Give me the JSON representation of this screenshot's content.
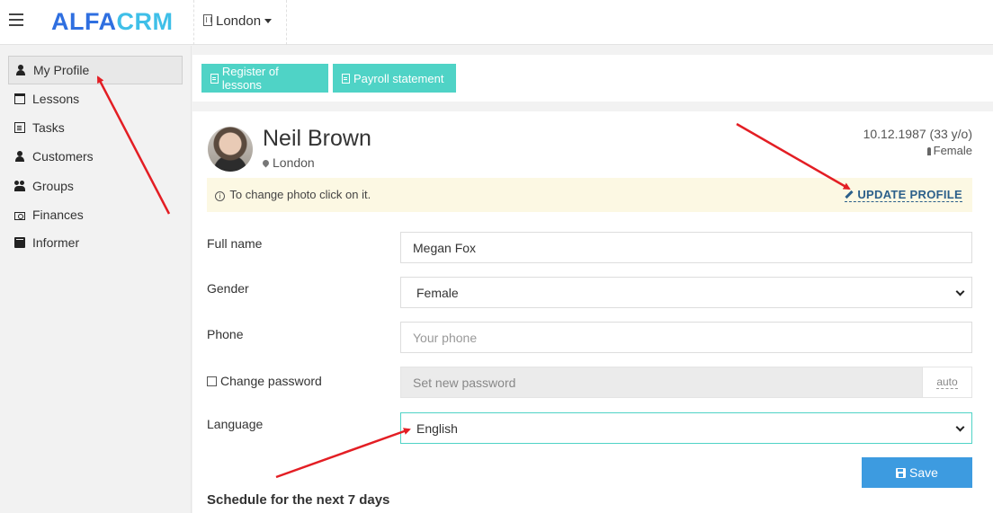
{
  "header": {
    "logo_part1": "ALFA",
    "logo_part2": "CRM",
    "branch": "London"
  },
  "sidebar": {
    "items": [
      {
        "label": "My Profile",
        "icon": "user-icon",
        "active": true
      },
      {
        "label": "Lessons",
        "icon": "calendar-icon"
      },
      {
        "label": "Tasks",
        "icon": "tasks-icon"
      },
      {
        "label": "Customers",
        "icon": "user-icon"
      },
      {
        "label": "Groups",
        "icon": "groups-icon"
      },
      {
        "label": "Finances",
        "icon": "money-icon"
      },
      {
        "label": "Informer",
        "icon": "book-icon"
      }
    ]
  },
  "toolbar": {
    "register_label": "Register of lessons",
    "payroll_label": "Payroll statement"
  },
  "profile": {
    "name": "Neil Brown",
    "city": "London",
    "dob": "10.12.1987 (33 y/o)",
    "gender": "Female",
    "notice": "To change photo click on it.",
    "update_label": "UPDATE PROFILE"
  },
  "form": {
    "fullname_label": "Full name",
    "fullname_value": "Megan Fox",
    "gender_label": "Gender",
    "gender_value": "Female",
    "phone_label": "Phone",
    "phone_placeholder": "Your phone",
    "password_label": "Change password",
    "password_placeholder": "Set new password",
    "password_addon": "auto",
    "language_label": "Language",
    "language_value": "English",
    "save_label": "Save"
  },
  "schedule": {
    "title": "Schedule for the next 7 days"
  },
  "colors": {
    "accent": "#4fd3c6",
    "primary": "#3d9be0",
    "logo_blue": "#2f6fe0",
    "logo_light": "#3fbfe8",
    "annotation_arrow": "#e31e24"
  }
}
